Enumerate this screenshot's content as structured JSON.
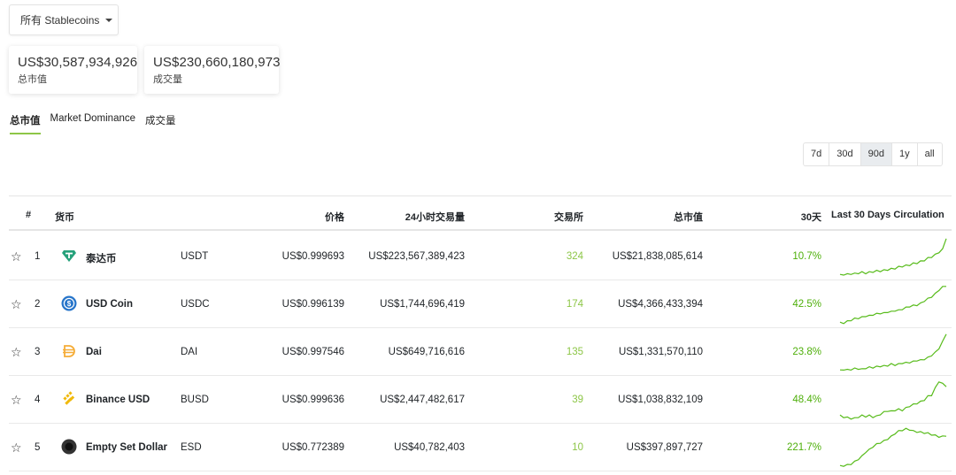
{
  "filter": {
    "label": "所有 Stablecoins"
  },
  "stats": {
    "market_cap": {
      "value": "US$30,587,934,926",
      "label": "总市值"
    },
    "volume": {
      "value": "US$230,660,180,973",
      "label": "成交量"
    }
  },
  "tabs": [
    "总市值",
    "Market Dominance",
    "成交量"
  ],
  "ranges": [
    "7d",
    "30d",
    "90d",
    "1y",
    "all"
  ],
  "active_range": "90d",
  "columns": {
    "rank": "#",
    "coin": "货币",
    "price": "价格",
    "volume": "24小时交易量",
    "exchanges": "交易所",
    "market_cap": "总市值",
    "change": "30天",
    "circulation": "Last 30 Days Circulation"
  },
  "colors": {
    "accent": "#8dc647",
    "positive": "#4eaf0a",
    "sparkline": "#57bb1a"
  },
  "coins": [
    {
      "rank": "1",
      "name": "泰达币",
      "symbol": "USDT",
      "price": "US$0.999693",
      "volume": "US$223,567,389,423",
      "exchanges": "324",
      "market_cap": "US$21,838,085,614",
      "change": "10.7%",
      "icon": "tether-icon",
      "circulation": [
        30,
        31,
        31,
        32,
        32,
        33,
        34,
        33,
        34,
        35,
        36,
        36,
        37,
        38,
        39,
        40,
        42,
        43,
        44,
        45,
        47,
        48,
        50,
        52,
        55,
        57,
        60,
        64,
        68,
        85
      ]
    },
    {
      "rank": "2",
      "name": "USD Coin",
      "symbol": "USDC",
      "price": "US$0.996139",
      "volume": "US$1,744,696,419",
      "exchanges": "174",
      "market_cap": "US$4,366,433,394",
      "change": "42.5%",
      "icon": "usd-coin-icon",
      "circulation": [
        20,
        20,
        22,
        24,
        26,
        27,
        28,
        30,
        30,
        32,
        33,
        34,
        34,
        36,
        36,
        38,
        38,
        40,
        42,
        44,
        45,
        46,
        48,
        52,
        55,
        58,
        62,
        68,
        72,
        74
      ]
    },
    {
      "rank": "3",
      "name": "Dai",
      "symbol": "DAI",
      "price": "US$0.997546",
      "volume": "US$649,716,616",
      "exchanges": "135",
      "market_cap": "US$1,331,570,110",
      "change": "23.8%",
      "icon": "dai-icon",
      "circulation": [
        20,
        22,
        21,
        22,
        23,
        23,
        22,
        24,
        25,
        25,
        26,
        27,
        27,
        28,
        30,
        29,
        30,
        32,
        32,
        33,
        34,
        36,
        36,
        38,
        40,
        44,
        48,
        55,
        65,
        78
      ]
    },
    {
      "rank": "4",
      "name": "Binance USD",
      "symbol": "BUSD",
      "price": "US$0.999636",
      "volume": "US$2,447,482,617",
      "exchanges": "39",
      "market_cap": "US$1,038,832,109",
      "change": "48.4%",
      "icon": "binance-usd-icon",
      "circulation": [
        22,
        20,
        19,
        18,
        18,
        20,
        22,
        21,
        22,
        20,
        21,
        24,
        27,
        29,
        28,
        30,
        31,
        30,
        33,
        36,
        38,
        40,
        42,
        45,
        50,
        52,
        62,
        72,
        68,
        65
      ]
    },
    {
      "rank": "5",
      "name": "Empty Set Dollar",
      "symbol": "ESD",
      "price": "US$0.772389",
      "volume": "US$40,782,403",
      "exchanges": "10",
      "market_cap": "US$397,897,727",
      "change": "221.7%",
      "icon": "empty-set-dollar-icon",
      "circulation": [
        12,
        13,
        14,
        16,
        20,
        25,
        30,
        38,
        42,
        48,
        52,
        55,
        58,
        62,
        66,
        72,
        76,
        78,
        80,
        79,
        76,
        75,
        74,
        73,
        72,
        70,
        68,
        66,
        66,
        68
      ]
    }
  ]
}
